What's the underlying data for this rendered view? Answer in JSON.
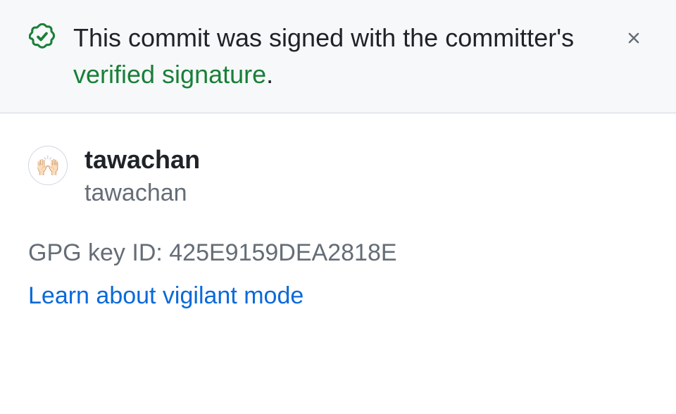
{
  "banner": {
    "text_before": "This commit was signed with the committer's ",
    "verified_text": "verified signature",
    "text_after": "."
  },
  "user": {
    "display_name": "tawachan",
    "handle": "tawachan",
    "avatar_emoji": "🙌🏻"
  },
  "gpg": {
    "label": "GPG key ID: ",
    "value": "425E9159DEA2818E"
  },
  "learn_link": "Learn about vigilant mode"
}
